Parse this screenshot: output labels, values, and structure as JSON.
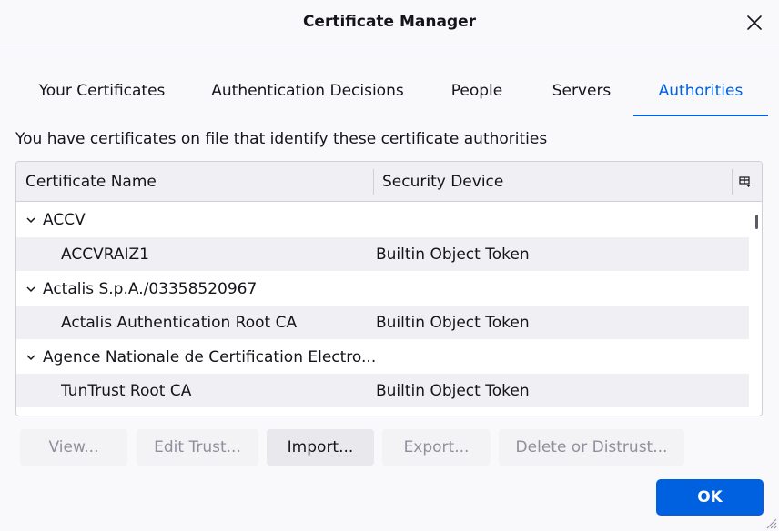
{
  "window": {
    "title": "Certificate Manager"
  },
  "tabs": [
    {
      "label": "Your Certificates",
      "selected": false
    },
    {
      "label": "Authentication Decisions",
      "selected": false
    },
    {
      "label": "People",
      "selected": false
    },
    {
      "label": "Servers",
      "selected": false
    },
    {
      "label": "Authorities",
      "selected": true
    }
  ],
  "description": "You have certificates on file that identify these certificate authorities",
  "tree": {
    "columns": {
      "name": "Certificate Name",
      "device": "Security Device"
    },
    "rows": [
      {
        "type": "group",
        "name": "ACCV",
        "device": "",
        "expanded": true
      },
      {
        "type": "child",
        "name": "ACCVRAIZ1",
        "device": "Builtin Object Token"
      },
      {
        "type": "group",
        "name": "Actalis S.p.A./03358520967",
        "device": "",
        "expanded": true
      },
      {
        "type": "child",
        "name": "Actalis Authentication Root CA",
        "device": "Builtin Object Token"
      },
      {
        "type": "group",
        "name": "Agence Nationale de Certification Electro...",
        "device": "",
        "expanded": true
      },
      {
        "type": "child",
        "name": "TunTrust Root CA",
        "device": "Builtin Object Token"
      }
    ]
  },
  "buttons": {
    "view": "View...",
    "edit_trust": "Edit Trust...",
    "import": "Import...",
    "export": "Export...",
    "delete": "Delete or Distrust...",
    "ok": "OK"
  },
  "colors": {
    "accent": "#0061e0",
    "text": "#15141a",
    "disabled_text": "#8f8f9d"
  }
}
